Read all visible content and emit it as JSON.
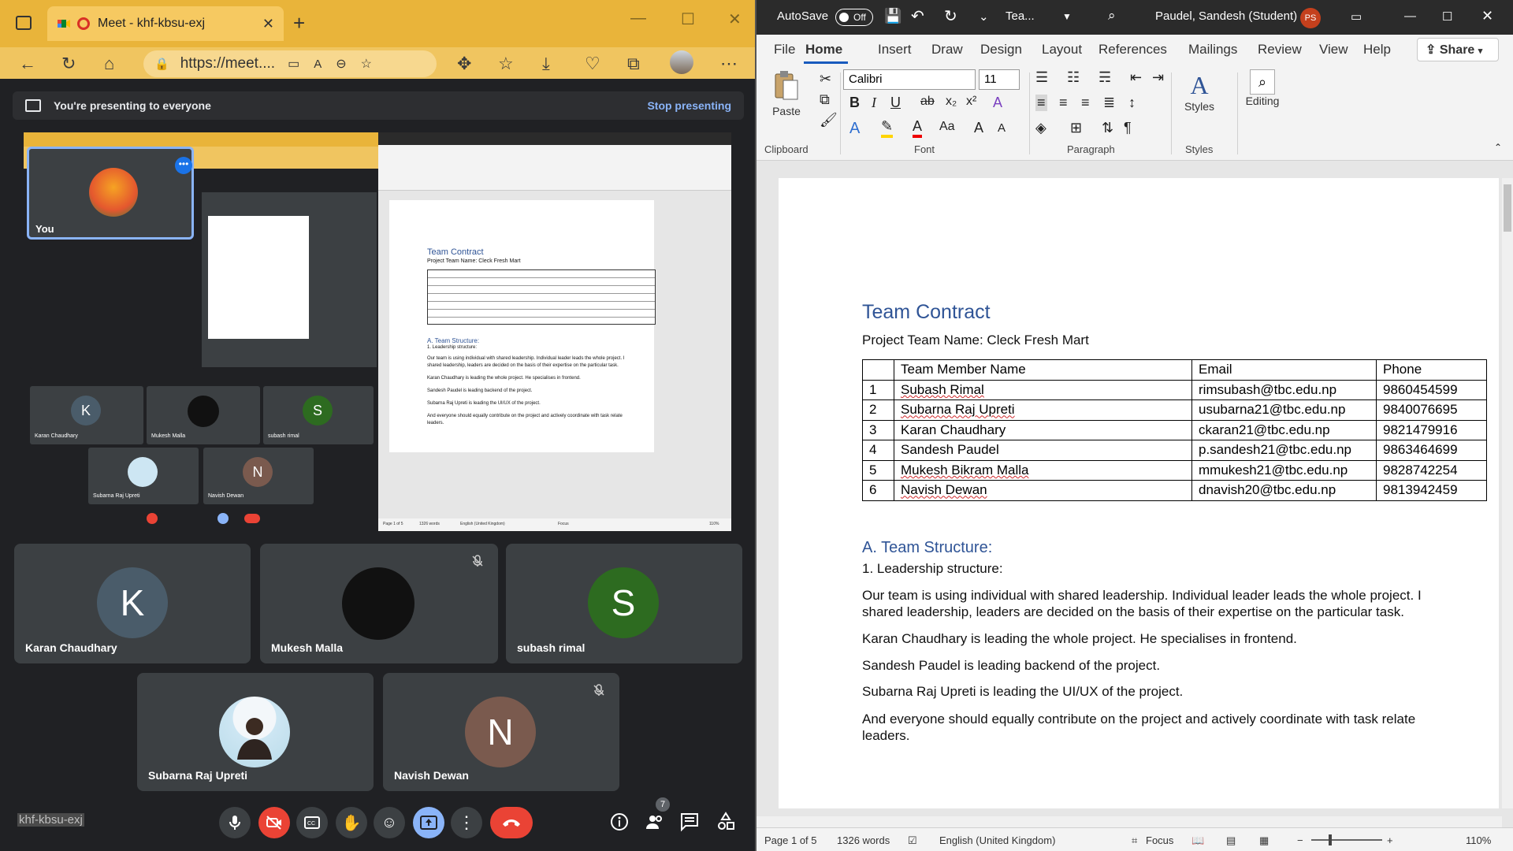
{
  "browser": {
    "tab_title": "Meet - khf-kbsu-exj",
    "url": "https://meet....",
    "presenting_text": "You're presenting to everyone",
    "stop_presenting": "Stop presenting",
    "meeting_code": "khf-kbsu-exj",
    "people_count": "7",
    "colors": {
      "tab_accent": "#e9b43a",
      "meet_bg": "#202124",
      "end_call": "#ea4335",
      "present_btn": "#8ab4f8"
    }
  },
  "preview": {
    "you_label": "You",
    "doc_heading": "Team Contract",
    "doc_team": "Project Team Name:  Cleck Fresh Mart",
    "doc_structure": "A. Team Structure:",
    "doc_leadership": "1. Leadership structure:",
    "doc_line1": "Our team is using individual with shared leadership. Individual leader leads the whole project. I",
    "doc_line2": "shared leadership, leaders are decided on the basis of their expertise on the particular task.",
    "doc_line3": "Karan Chaudhary is leading the whole project. He specialises in frontend.",
    "doc_line4": "Sandesh Paudel is leading backend of the project.",
    "doc_line5": "Subarna Raj Upreti is leading the UI/UX of the project.",
    "doc_line6": "And everyone should equally contribute on the project and actively coordinate with task relate",
    "doc_line7": "leaders.",
    "tile_k": "Karan Chaudhary",
    "tile_m": "Mukesh Malla",
    "tile_s": "subash rimal",
    "tile_sr": "Subarna Raj Upreti",
    "tile_n": "Navish Dewan",
    "word_status": "Page 1 of 5",
    "word_words": "1326 words",
    "word_lang": "English (United Kingdom)",
    "word_focus": "Focus",
    "word_zoom": "110%"
  },
  "participants": [
    {
      "name": "Karan Chaudhary",
      "initial": "K",
      "color": "#4a5c6a",
      "muted": false
    },
    {
      "name": "Mukesh Malla",
      "initial": "",
      "color": "#111111",
      "muted": true
    },
    {
      "name": "subash rimal",
      "initial": "S",
      "color": "#2d6b20",
      "muted": false
    },
    {
      "name": "Subarna Raj Upreti",
      "initial": "",
      "color": "#cde6f3",
      "muted": false
    },
    {
      "name": "Navish Dewan",
      "initial": "N",
      "color": "#7a5a4e",
      "muted": true
    }
  ],
  "word": {
    "autosave": "AutoSave",
    "autosave_state": "Off",
    "doc_name": "Tea...",
    "user": "Paudel, Sandesh (Student)",
    "user_initials": "PS",
    "menu": [
      "File",
      "Home",
      "Insert",
      "Draw",
      "Design",
      "Layout",
      "References",
      "Mailings",
      "Review",
      "View",
      "Help"
    ],
    "share": "Share",
    "font_name": "Calibri",
    "font_size": "11",
    "groups": {
      "clipboard": "Clipboard",
      "font": "Font",
      "paragraph": "Paragraph",
      "styles": "Styles"
    },
    "paste": "Paste",
    "styles_btn": "Styles",
    "editing_btn": "Editing",
    "doc": {
      "title": "Team Contract",
      "project_team": "Project Team Name:  Cleck Fresh Mart",
      "headers": [
        "",
        "Team Member Name",
        "Email",
        "Phone"
      ],
      "rows": [
        [
          "1",
          "Subash Rimal",
          "rimsubash@tbc.edu.np",
          "9860454599"
        ],
        [
          "2",
          "Subarna Raj Upreti",
          "usubarna21@tbc.edu.np",
          "9840076695"
        ],
        [
          "3",
          "Karan Chaudhary",
          "ckaran21@tbc.edu.np",
          "9821479916"
        ],
        [
          "4",
          "Sandesh Paudel",
          "p.sandesh21@tbc.edu.np",
          "9863464699"
        ],
        [
          "5",
          "Mukesh Bikram Malla",
          "mmukesh21@tbc.edu.np",
          "9828742254"
        ],
        [
          "6",
          "Navish Dewan",
          "dnavish20@tbc.edu.np",
          "9813942459"
        ]
      ],
      "section_heading": "A. Team Structure:",
      "leadership": "1. Leadership structure:",
      "para1_l1": "Our team is using individual with shared leadership. Individual leader leads the whole project. I",
      "para1_l2": "shared leadership, leaders are decided on the basis of their expertise on the particular task.",
      "para2": "Karan Chaudhary is leading the whole project. He specialises in frontend.",
      "para3": "Sandesh Paudel is leading backend of the project.",
      "para4": "Subarna Raj Upreti is leading the UI/UX of the project.",
      "para5_l1": "And everyone should equally contribute on the project and actively coordinate with task relate",
      "para5_l2": "leaders."
    },
    "status": {
      "page": "Page 1 of 5",
      "words": "1326 words",
      "language": "English (United Kingdom)",
      "focus": "Focus",
      "zoom": "110%"
    },
    "colors": {
      "title_bar": "#2b2b2b",
      "heading_blue": "#2f5496",
      "accent": "#185abd"
    }
  }
}
